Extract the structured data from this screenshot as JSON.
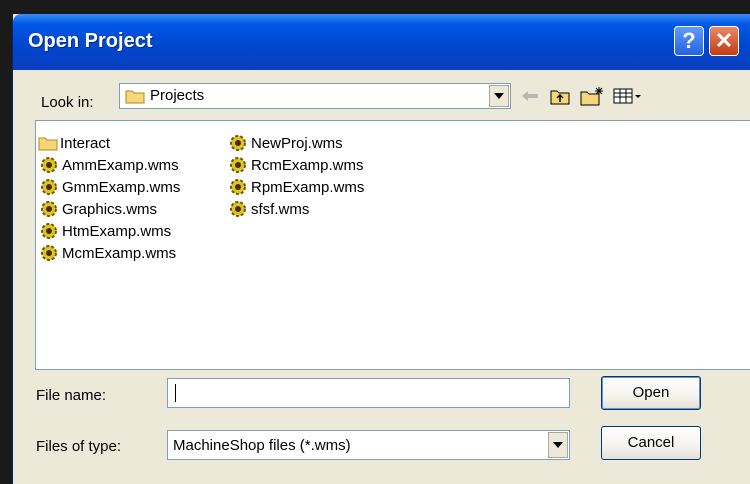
{
  "dialog": {
    "title": "Open Project",
    "help_label": "?",
    "close_label": "✕"
  },
  "look_in": {
    "label": "Look in:",
    "value": "Projects",
    "icon": "folder-icon"
  },
  "toolbar": [
    {
      "name": "back-icon"
    },
    {
      "name": "up-folder-icon"
    },
    {
      "name": "new-folder-icon"
    },
    {
      "name": "view-menu-icon"
    }
  ],
  "files": [
    {
      "name": "Interact",
      "icon": "folder-icon"
    },
    {
      "name": "AmmExamp.wms",
      "icon": "wms-gear-icon"
    },
    {
      "name": "GmmExamp.wms",
      "icon": "wms-gear-icon"
    },
    {
      "name": "Graphics.wms",
      "icon": "wms-gear-icon"
    },
    {
      "name": "HtmExamp.wms",
      "icon": "wms-gear-icon"
    },
    {
      "name": "McmExamp.wms",
      "icon": "wms-gear-icon"
    },
    {
      "name": "NewProj.wms",
      "icon": "wms-gear-icon"
    },
    {
      "name": "RcmExamp.wms",
      "icon": "wms-gear-icon"
    },
    {
      "name": "RpmExamp.wms",
      "icon": "wms-gear-icon"
    },
    {
      "name": "sfsf.wms",
      "icon": "wms-gear-icon"
    }
  ],
  "file_name": {
    "label": "File name:",
    "value": ""
  },
  "file_type": {
    "label": "Files of type:",
    "value": "MachineShop files (*.wms)"
  },
  "buttons": {
    "open": "Open",
    "cancel": "Cancel"
  }
}
